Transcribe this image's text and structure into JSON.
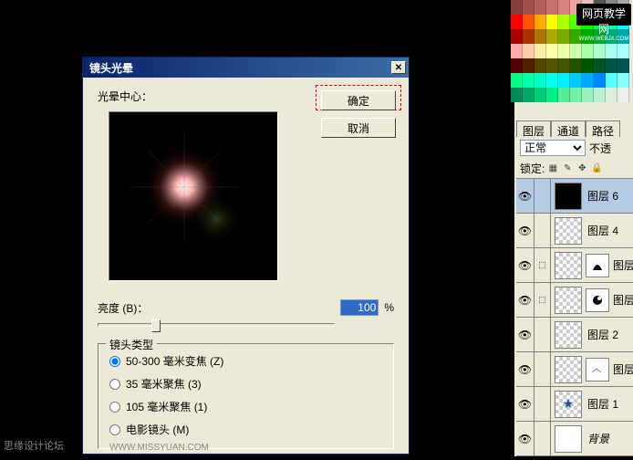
{
  "dialog": {
    "title": "镜头光晕",
    "center_label": "光晕中心：",
    "ok_label": "确定",
    "cancel_label": "取消",
    "brightness_label": "亮度 (B)：",
    "brightness_value": "100",
    "percent": "%",
    "lens_group_label": "镜头类型",
    "lens_options": [
      "50-300 毫米变焦 (Z)",
      "35 毫米聚焦 (3)",
      "105 毫米聚焦 (1)",
      "电影镜头 (M)"
    ]
  },
  "tabs": {
    "layers": "图层",
    "channels": "通道",
    "paths": "路径"
  },
  "blend": {
    "mode": "正常",
    "opacity_label": "不透"
  },
  "lock_label": "锁定:",
  "layers": [
    {
      "name": "图层 6"
    },
    {
      "name": "图层 4"
    },
    {
      "name": "图层"
    },
    {
      "name": "图层"
    },
    {
      "name": "图层 2"
    },
    {
      "name": "图层"
    },
    {
      "name": "图层 1"
    },
    {
      "name": "背景"
    }
  ],
  "brand": {
    "line1": "网页教学网",
    "line2": "WWW.WEBJX.COM"
  },
  "watermark": "思缘设计论坛",
  "watermark_url": "WWW.MISSYUAN.COM"
}
